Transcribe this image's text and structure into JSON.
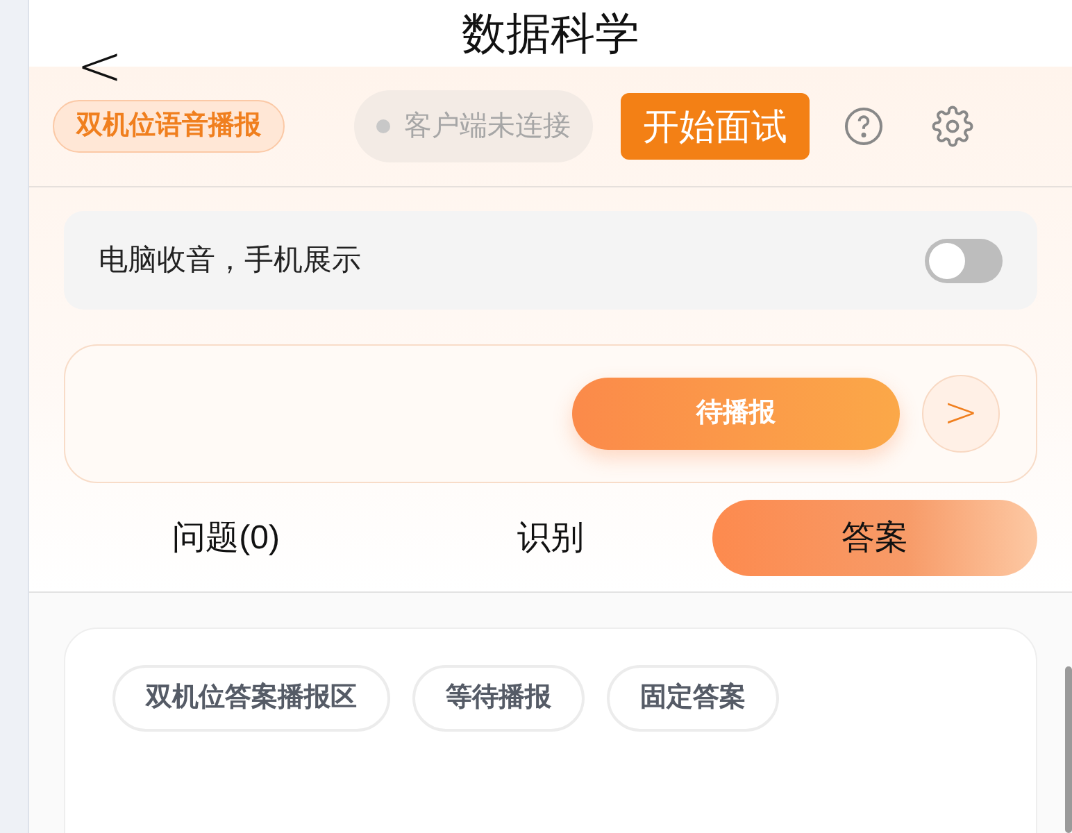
{
  "header": {
    "back": "<",
    "title": "数据科学"
  },
  "toolbar": {
    "mode_badge": "双机位语音播报",
    "client_status": {
      "label": "客户端未连接",
      "connected": false
    },
    "start_button": "开始面试"
  },
  "toggle_row": {
    "label": "电脑收音，手机展示",
    "on": false
  },
  "broadcast": {
    "button": "待播报",
    "next": ">"
  },
  "tabs": [
    {
      "label": "问题(0)",
      "selected": false
    },
    {
      "label": "识别",
      "selected": false
    },
    {
      "label": "答案",
      "selected": true
    }
  ],
  "tags": [
    "双机位答案播报区",
    "等待播报",
    "固定答案"
  ]
}
